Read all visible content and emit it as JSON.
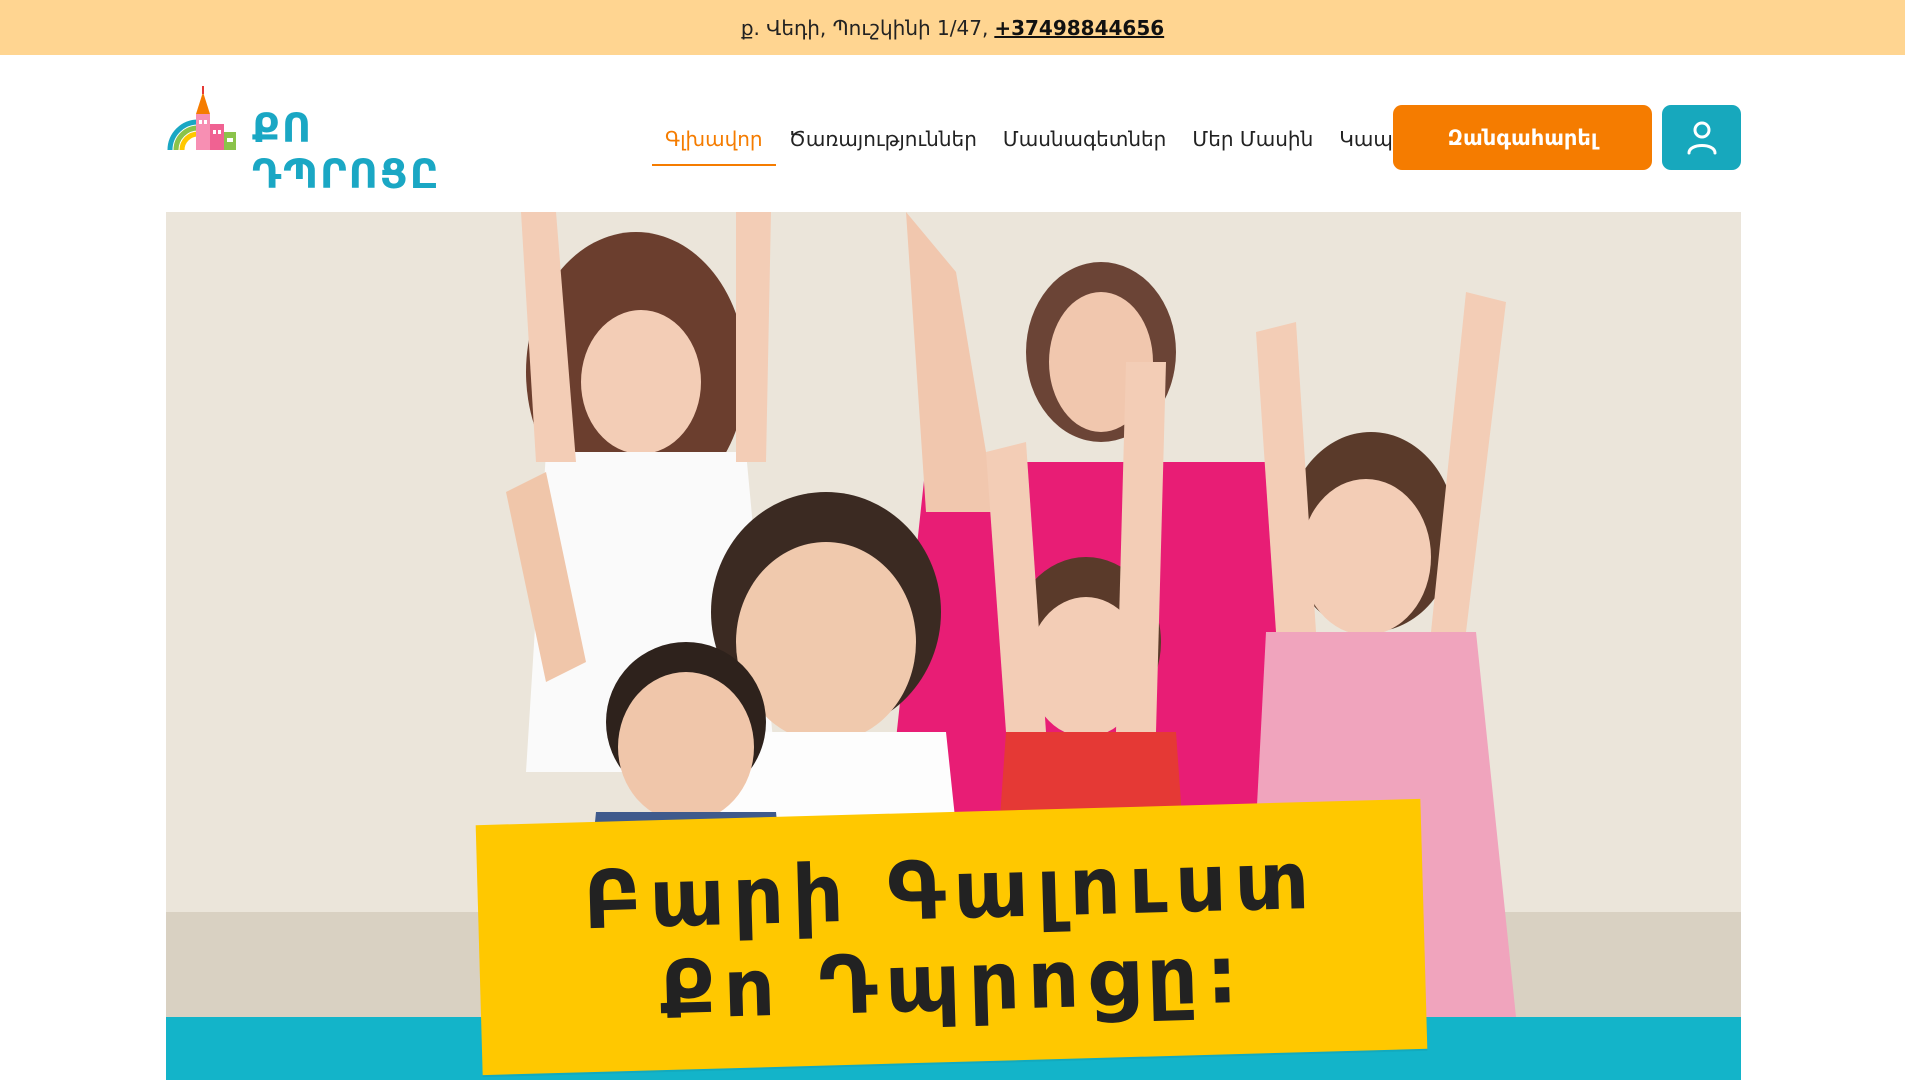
{
  "topbar": {
    "address": "ք. Վեդի, Պուշկինի 1/47,",
    "phone": "+37498844656"
  },
  "header": {
    "logo_text": "ՔՈ ԴՊՐՈՑԸ",
    "nav": [
      {
        "label": "Գլխավոր",
        "active": true
      },
      {
        "label": "Ծառայություններ",
        "active": false
      },
      {
        "label": "Մասնագետներ",
        "active": false
      },
      {
        "label": "Մեր Մասին",
        "active": false
      },
      {
        "label": "Կապ",
        "active": false
      }
    ],
    "call_button": "Զանգահարել",
    "account_icon": "user-icon"
  },
  "hero": {
    "banner_line_1": "Բարի Գալուստ",
    "banner_line_2": "Քո Դպրոցը:"
  },
  "colors": {
    "topbar_bg": "#ffd591",
    "accent_orange": "#f57c00",
    "accent_teal": "#17a8bd",
    "banner_yellow": "#ffc800"
  }
}
